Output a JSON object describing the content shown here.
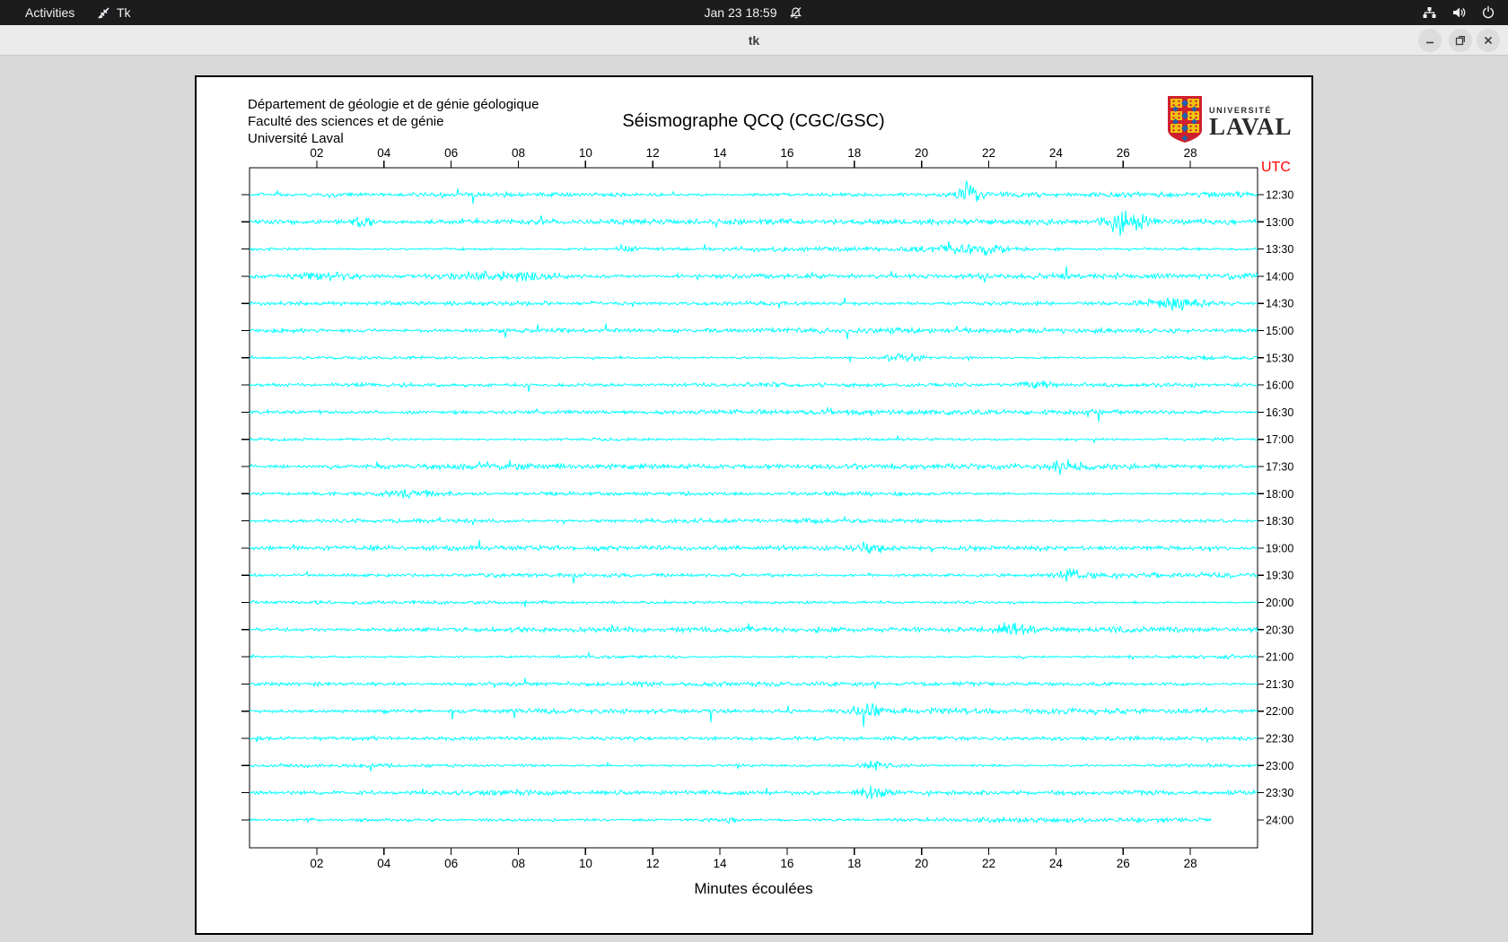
{
  "topbar": {
    "activities": "Activities",
    "app_name": "Tk",
    "clock": "Jan 23 18:59"
  },
  "titlebar": {
    "title": "tk"
  },
  "header": {
    "line1": "Département de géologie et de génie géologique",
    "line2": "Faculté des sciences et de génie",
    "line3": "Université Laval"
  },
  "logo": {
    "line1": "UNIVERSITÉ",
    "line2": "LAVAL"
  },
  "chart_data": {
    "type": "line",
    "title": "Séismographe QCQ (CGC/GSC)",
    "xlabel": "Minutes écoulées",
    "ylabel_right": "UTC",
    "x_range_minutes": [
      0,
      30
    ],
    "x_tick_minutes": [
      2,
      4,
      6,
      8,
      10,
      12,
      14,
      16,
      18,
      20,
      22,
      24,
      26,
      28
    ],
    "x_tick_labels": [
      "02",
      "04",
      "06",
      "08",
      "10",
      "12",
      "14",
      "16",
      "18",
      "20",
      "22",
      "24",
      "26",
      "28"
    ],
    "trace_labels": [
      "12:30",
      "13:00",
      "13:30",
      "14:00",
      "14:30",
      "15:00",
      "15:30",
      "16:00",
      "16:30",
      "17:00",
      "17:30",
      "18:00",
      "18:30",
      "19:00",
      "19:30",
      "20:00",
      "20:30",
      "21:00",
      "21:30",
      "22:00",
      "22:30",
      "23:00",
      "23:30",
      "24:00"
    ],
    "trace_color": "#00ffff",
    "axis_color": "#000000",
    "utc_color": "#ff0000",
    "background": "#ffffff",
    "noise_base_amp": 2.1,
    "seed": 20230123,
    "last_trace_end_fraction": 0.954,
    "events": [
      {
        "trace": 0,
        "minute": 21.4,
        "gain": 5.0,
        "width": 0.3
      },
      {
        "trace": 1,
        "minute": 26.1,
        "gain": 4.2,
        "width": 0.55
      },
      {
        "trace": 1,
        "minute": 3.4,
        "gain": 2.2,
        "width": 0.35
      },
      {
        "trace": 2,
        "minute": 11.2,
        "gain": 2.6,
        "width": 0.25
      },
      {
        "trace": 2,
        "minute": 21.5,
        "gain": 2.2,
        "width": 0.9
      },
      {
        "trace": 3,
        "minute": 1.9,
        "gain": 2.8,
        "width": 1.1
      },
      {
        "trace": 3,
        "minute": 7.4,
        "gain": 2.2,
        "width": 1.6
      },
      {
        "trace": 4,
        "minute": 27.4,
        "gain": 3.2,
        "width": 0.8
      },
      {
        "trace": 6,
        "minute": 19.4,
        "gain": 2.6,
        "width": 0.6
      },
      {
        "trace": 7,
        "minute": 23.4,
        "gain": 2.0,
        "width": 0.5
      },
      {
        "trace": 10,
        "minute": 24.3,
        "gain": 2.1,
        "width": 0.45
      },
      {
        "trace": 11,
        "minute": 4.9,
        "gain": 2.3,
        "width": 0.85
      },
      {
        "trace": 13,
        "minute": 18.4,
        "gain": 2.2,
        "width": 0.4
      },
      {
        "trace": 14,
        "minute": 24.6,
        "gain": 2.8,
        "width": 0.5
      },
      {
        "trace": 16,
        "minute": 22.7,
        "gain": 2.3,
        "width": 0.55
      },
      {
        "trace": 19,
        "minute": 18.4,
        "gain": 3.0,
        "width": 0.35
      },
      {
        "trace": 21,
        "minute": 18.6,
        "gain": 2.4,
        "width": 0.45
      },
      {
        "trace": 22,
        "minute": 18.5,
        "gain": 2.8,
        "width": 0.45
      },
      {
        "trace": 23,
        "minute": 13.9,
        "gain": 2.0,
        "width": 0.6
      }
    ]
  }
}
